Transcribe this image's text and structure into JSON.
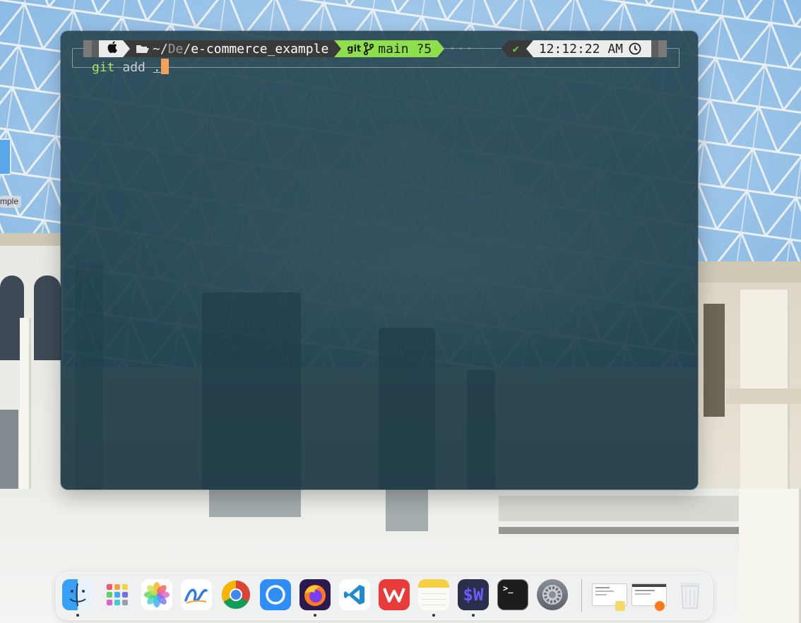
{
  "desktop": {
    "folder_label": "mple"
  },
  "terminal": {
    "prompt": {
      "os_icon": "apple-icon",
      "folder_icon": "folder-open-icon",
      "path_home": "~/",
      "path_abbrev": "De",
      "path_sep": "/",
      "path_dir": "e-commerce_example",
      "git_label": "git",
      "branch_icon": "git-branch-icon",
      "branch": "main ?5",
      "dots": "···",
      "status_icon": "check-icon",
      "status": "✔",
      "time": "12:12:22 AM",
      "clock_icon": "clock-icon"
    },
    "command": {
      "cmd": "git",
      "args": " add ",
      "dot": "."
    },
    "colors": {
      "prompt_bg": "#3a3a3a",
      "git_segment_bg": "#8ee04a",
      "command_green": "#a7e25b",
      "cursor": "#f3a05a"
    }
  },
  "dock": {
    "apps": [
      {
        "name": "Finder",
        "icon": "finder-icon",
        "running": true
      },
      {
        "name": "Launchpad",
        "icon": "launchpad-icon",
        "running": false
      },
      {
        "name": "Photos",
        "icon": "photos-icon",
        "running": false
      },
      {
        "name": "Freeform",
        "icon": "freeform-icon",
        "running": false
      },
      {
        "name": "Chrome",
        "icon": "chrome-icon",
        "running": false
      },
      {
        "name": "Messenger",
        "icon": "chat-icon",
        "running": false
      },
      {
        "name": "Firefox",
        "icon": "firefox-icon",
        "running": true
      },
      {
        "name": "VS Code",
        "icon": "vscode-icon",
        "running": false
      },
      {
        "name": "WPS Office",
        "icon": "wps-icon",
        "running": false
      },
      {
        "name": "Notes",
        "icon": "notes-icon",
        "running": true
      },
      {
        "name": "Warp",
        "icon": "warp-icon",
        "running": true
      },
      {
        "name": "Terminal",
        "icon": "terminal-icon",
        "running": false
      },
      {
        "name": "System Settings",
        "icon": "settings-icon",
        "running": false
      }
    ],
    "warp_label": "$W",
    "terminal_label": ">_"
  }
}
